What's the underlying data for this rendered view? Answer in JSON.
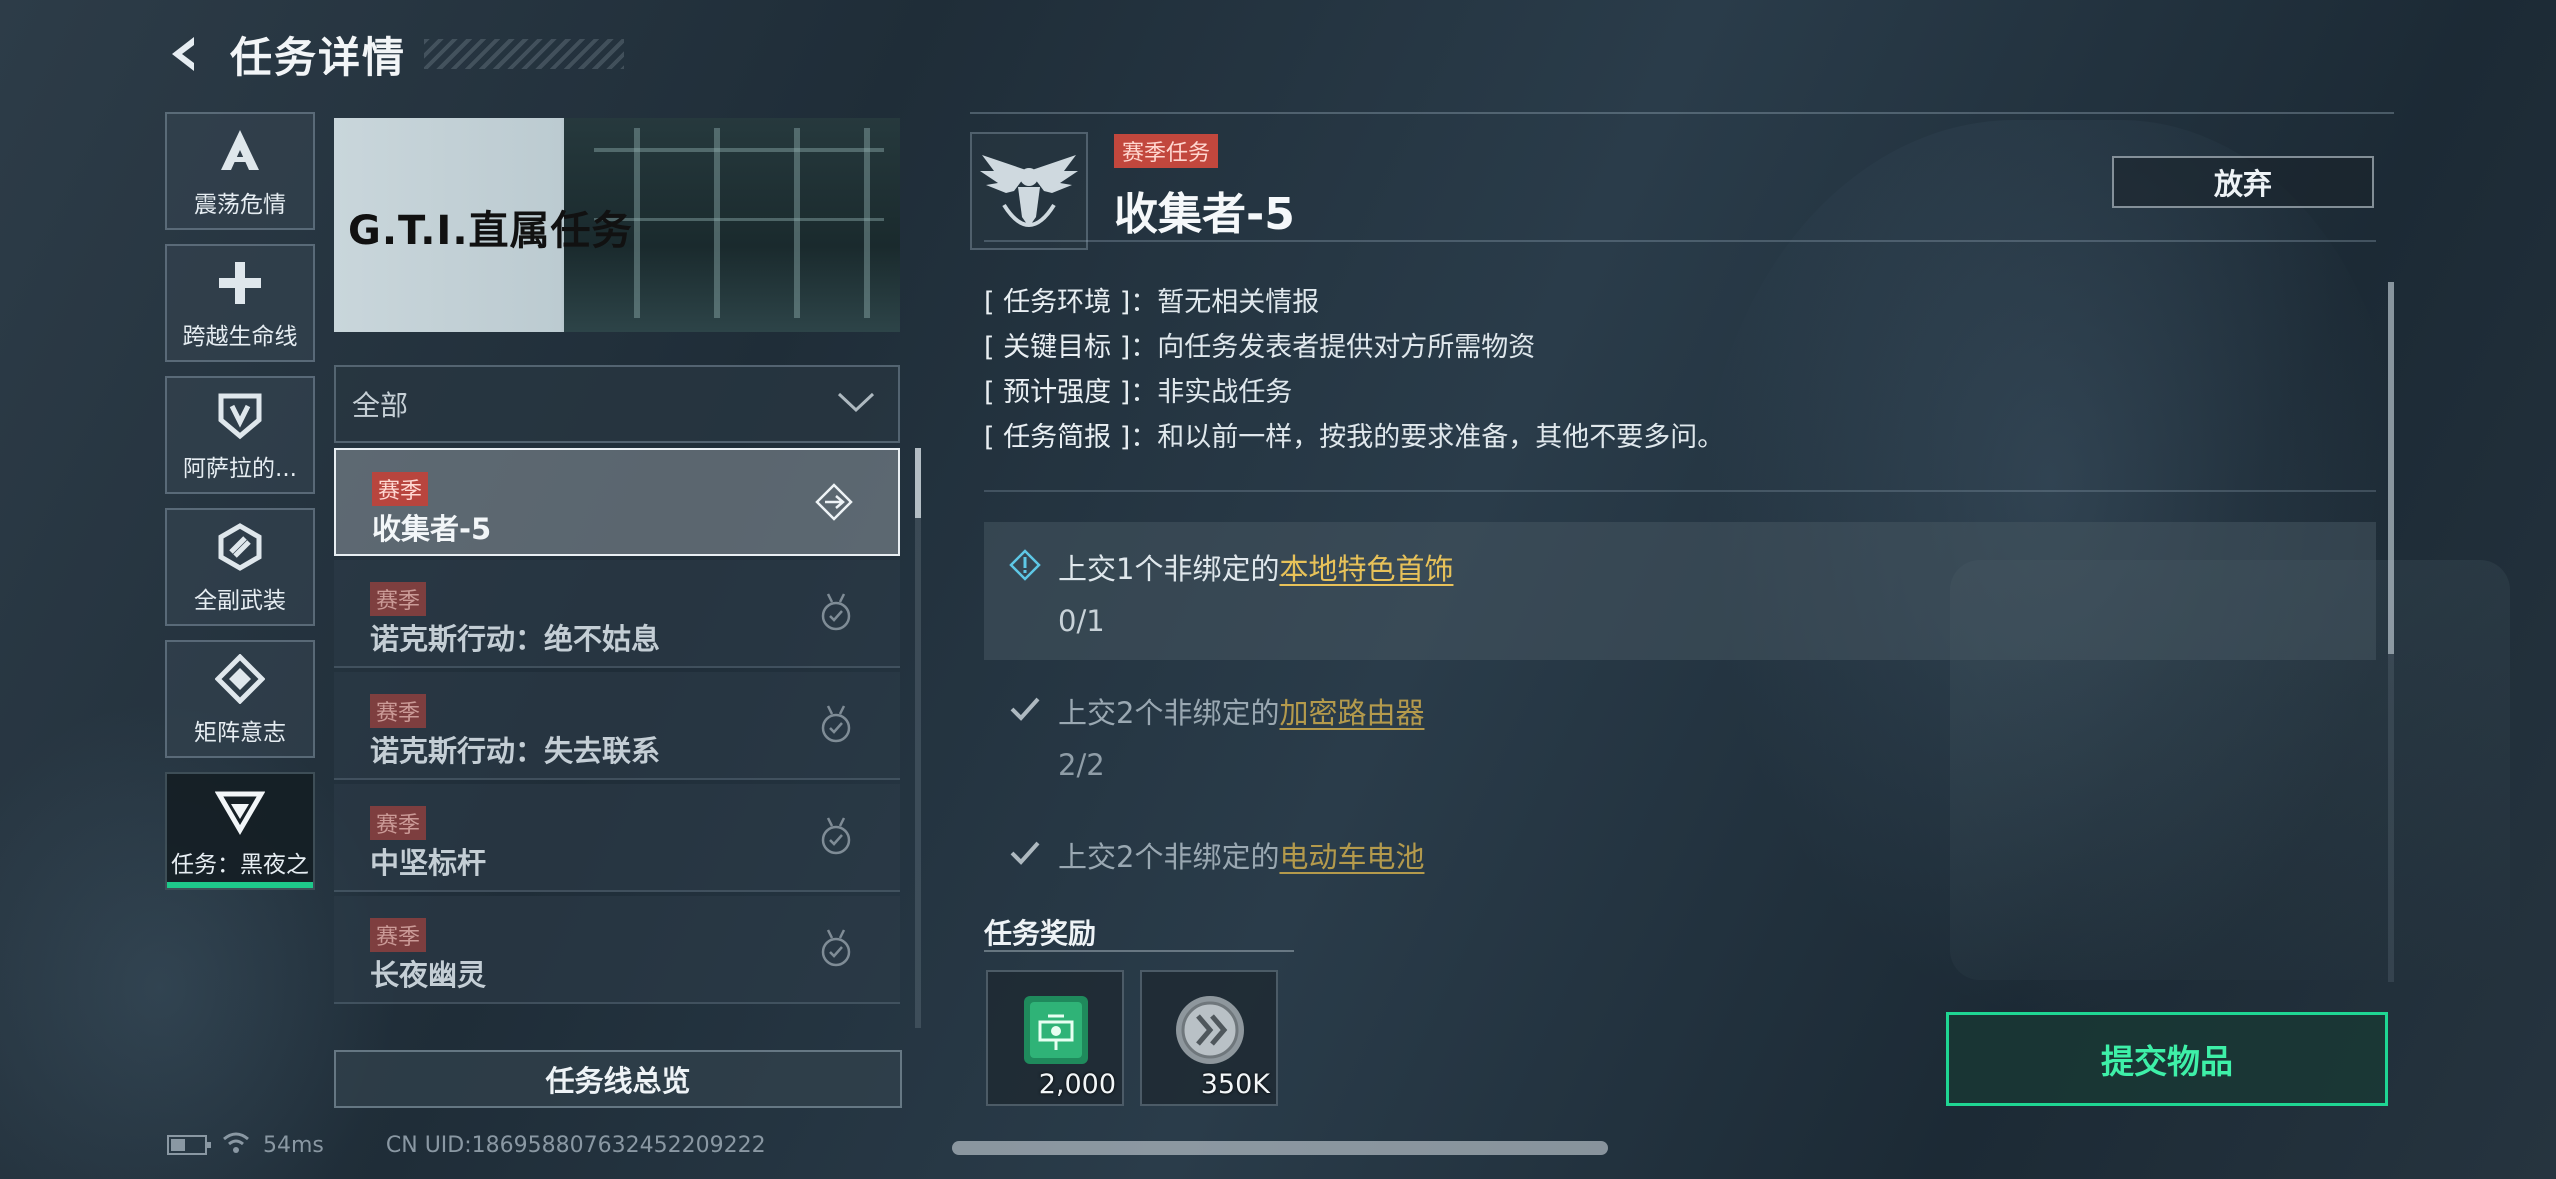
{
  "header": {
    "title": "任务详情"
  },
  "categories": [
    {
      "label": "震荡危情",
      "icon": "a-wing-icon",
      "active": false
    },
    {
      "label": "跨越生命线",
      "icon": "cross-icon",
      "active": false
    },
    {
      "label": "阿萨拉的...",
      "icon": "shield-v-icon",
      "active": false
    },
    {
      "label": "全副武装",
      "icon": "hex-icon",
      "active": false
    },
    {
      "label": "矩阵意志",
      "icon": "matrix-icon",
      "active": false
    },
    {
      "label": "任务：黑夜之",
      "icon": "g-chevron-icon",
      "active": true
    }
  ],
  "banner": {
    "title": "G.T.I.直属任务"
  },
  "filter": {
    "value": "全部"
  },
  "quests": [
    {
      "tag": "赛季",
      "name": "收集者-5",
      "selected": true
    },
    {
      "tag": "赛季",
      "name": "诺克斯行动：绝不姑息",
      "selected": false
    },
    {
      "tag": "赛季",
      "name": "诺克斯行动：失去联系",
      "selected": false
    },
    {
      "tag": "赛季",
      "name": "中坚标杆",
      "selected": false
    },
    {
      "tag": "赛季",
      "name": "长夜幽灵",
      "selected": false
    }
  ],
  "overview_button": "任务线总览",
  "status": {
    "ping": "54ms",
    "uid": "CN UID:186958807632452209222"
  },
  "detail": {
    "tag": "赛季任务",
    "name": "收集者-5",
    "abandon": "放弃",
    "info": [
      {
        "key": "[ 任务环境 ]",
        "value": "：暂无相关情报"
      },
      {
        "key": "[ 关键目标 ]",
        "value": "：向任务发表者提供对方所需物资"
      },
      {
        "key": "[ 预计强度 ]",
        "value": "：非实战任务"
      },
      {
        "key": "[ 任务简报 ]",
        "value": "：和以前一样，按我的要求准备，其他不要多问。"
      }
    ],
    "objectives": [
      {
        "prefix": "上交1个非绑定的",
        "item": "本地特色首饰",
        "progress": "0/1",
        "done": false
      },
      {
        "prefix": "上交2个非绑定的",
        "item": "加密路由器",
        "progress": "2/2",
        "done": true
      },
      {
        "prefix": "上交2个非绑定的",
        "item": "电动车电池",
        "progress": "",
        "done": true
      }
    ],
    "rewards_title": "任务奖励",
    "rewards": [
      {
        "icon": "green-card-icon",
        "count": "2,000"
      },
      {
        "icon": "silver-coin-icon",
        "count": "350K"
      }
    ],
    "submit": "提交物品"
  },
  "colors": {
    "accent": "#1fd693",
    "season_tag": "#c2473d",
    "item_link": "#e8c259"
  }
}
